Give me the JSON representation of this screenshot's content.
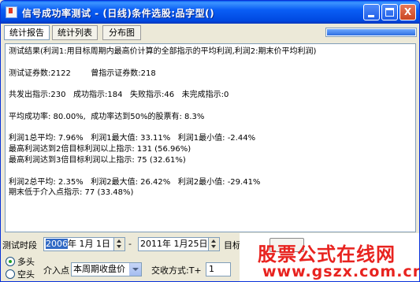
{
  "window": {
    "title": "信号成功率测试 - (日线)条件选股:品字型()"
  },
  "title_buttons": {
    "close_label": "X"
  },
  "tabs": [
    {
      "label": "统计报告",
      "active": true
    },
    {
      "label": "统计列表",
      "active": false
    },
    {
      "label": "分布图",
      "active": false
    }
  ],
  "progress": {
    "value": 1.0
  },
  "report": {
    "lines": [
      "测试结果(利润1:用目标周期内最高价计算的全部指示的平均利润,利润2:期末价平均利润)",
      "",
      "测试证券数:2122        曾指示证券数:218",
      "",
      "共发出指示:230   成功指示:184   失败指示:46   未完成指示:0",
      "",
      "平均成功率: 80.00%,  成功率达到50%的股票有: 8.3%",
      "",
      "利润1总平均: 7.96%   利润1最大值: 33.11%   利润1最小值: -2.44%",
      "最高利润达到2倍目标利润以上指示: 131 (56.96%)",
      "最高利润达到3倍目标利润以上指示: 75 (32.61%)",
      "",
      "利润2总平均: 2.35%   利润2最大值: 26.42%   利润2最小值: -29.41%",
      "期末低于介入点指示: 77 (33.48%)"
    ]
  },
  "controls": {
    "period_label": "测试时段",
    "start_date_year": "2006",
    "start_date_rest": "年  1月  1日",
    "range_sep": "-",
    "end_date": "2011年 1月25日",
    "target_label": "目标,",
    "long_label": "多头",
    "short_label": "空头",
    "direction_selected": "long",
    "entry_label": "介入点",
    "entry_value": "本周期收盘价",
    "trade_label": "交收方式:T+",
    "trade_value": "1"
  },
  "watermark": {
    "line1": "股票公式在线网",
    "line2": "www.gszx.com.cn"
  },
  "colors": {
    "title_bar": "#0a5ef5",
    "watermark": "#e8231f",
    "window_bg": "#ece9d8"
  }
}
